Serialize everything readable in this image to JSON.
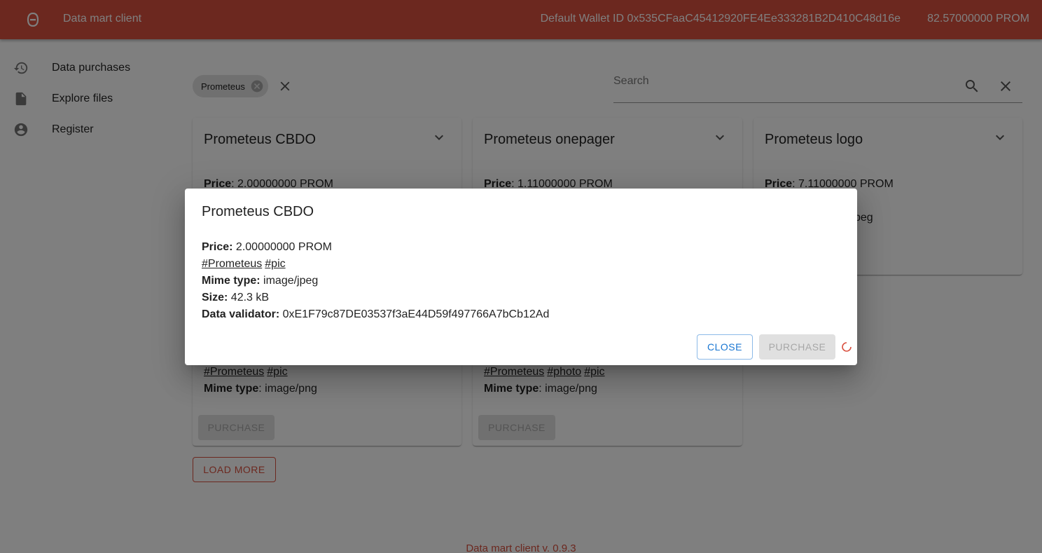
{
  "header": {
    "app_title": "Data mart client",
    "wallet_text": "Default Wallet ID 0x535CFaaC45412920FE4Ee333281B2D410C48d16e",
    "balance": "82.57000000 PROM"
  },
  "sidebar": {
    "items": [
      {
        "label": "Data purchases",
        "icon": "history-icon"
      },
      {
        "label": "Explore files",
        "icon": "file-icon"
      },
      {
        "label": "Register",
        "icon": "account-circle-icon"
      }
    ]
  },
  "filters": {
    "chips": [
      "Prometeus"
    ]
  },
  "search": {
    "placeholder": "Search",
    "value": ""
  },
  "cards": [
    {
      "title": "Prometeus CBDO",
      "price_label": "Price",
      "price": "2.00000000 PROM"
    },
    {
      "title": "Prometeus onepager",
      "price_label": "Price",
      "price": "1.11000000 PROM"
    },
    {
      "title": "Prometeus logo",
      "price_label": "Price",
      "price": "7.11000000 PROM",
      "partial_text": "/jpeg"
    },
    {
      "tags": [
        "#Prometeus",
        "#pic"
      ],
      "mime_label": "Mime type",
      "mime": "image/png",
      "purchase_label": "PURCHASE"
    },
    {
      "tags": [
        "#Prometeus",
        "#photo",
        "#pic"
      ],
      "mime_label": "Mime type",
      "mime": "image/png",
      "purchase_label": "PURCHASE"
    }
  ],
  "load_more_label": "LOAD MORE",
  "footer": "Data mart client v. 0.9.3",
  "dialog": {
    "title": "Prometeus CBDO",
    "price_label": "Price:",
    "price": "2.00000000 PROM",
    "tags": [
      "#Prometeus",
      "#pic"
    ],
    "mime_label": "Mime type:",
    "mime": "image/jpeg",
    "size_label": "Size:",
    "size": "42.3 kB",
    "validator_label": "Data validator:",
    "validator": "0xE1F79c87DE03537f3aE44D59f497766A7bCb12Ad",
    "close_label": "CLOSE",
    "purchase_label": "PURCHASE"
  },
  "colors": {
    "brand": "#d9503f",
    "close_button": "#1976d2"
  }
}
